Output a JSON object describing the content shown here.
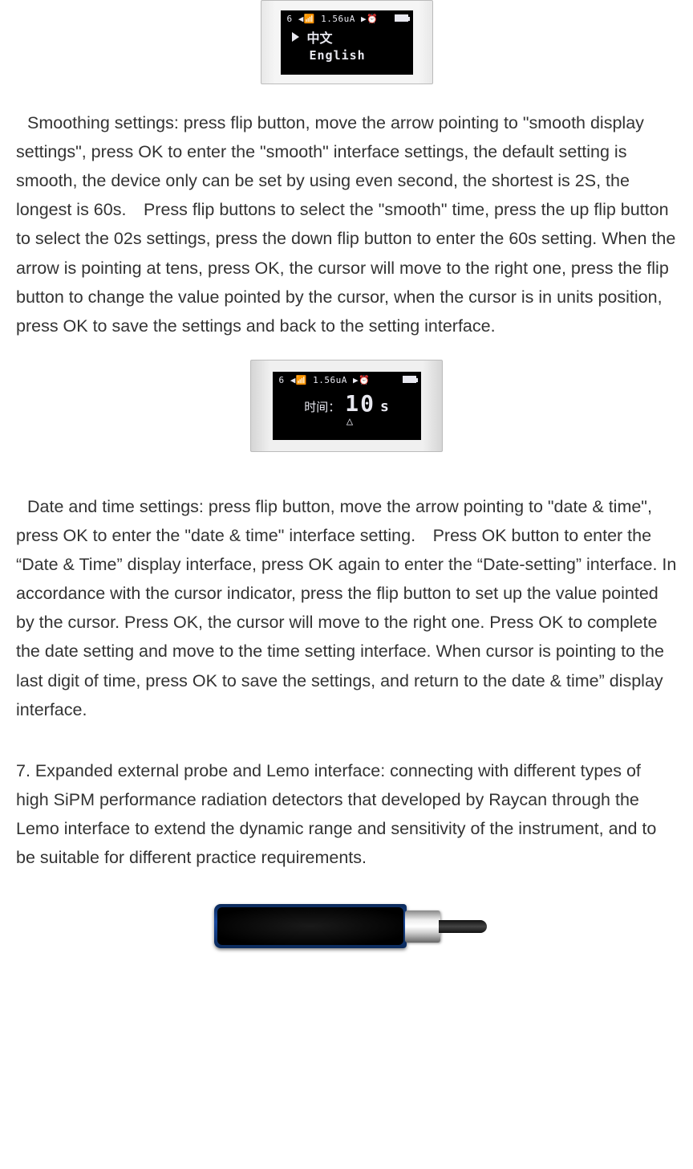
{
  "figure1": {
    "status": "6  ◀📶  1.56uA  ▶⏰",
    "row1_text": "中文",
    "row2_text": "English"
  },
  "para1": "Smoothing settings: press flip button, move the arrow pointing to \"smooth display settings\", press OK to enter the \"smooth\" interface settings, the default setting is smooth, the device only can be set by using even second, the shortest is 2S, the longest is 60s. Press flip buttons to select the \"smooth\" time, press the up flip button to select the 02s settings, press the down flip button to enter the 60s setting. When the arrow is pointing at tens, press OK, the cursor will move to the right one, press the flip button to change the value pointed by the cursor, when the cursor is in units position, press OK to save the settings and back to the setting interface.",
  "figure2": {
    "status": "6  ◀📶  1.56uA  ▶⏰",
    "label": "时间：",
    "value": "10",
    "unit": "s",
    "caret": "△"
  },
  "para2": "Date and time settings: press flip button, move the arrow pointing to \"date & time\", press OK to enter the \"date & time\" interface setting. Press OK button to enter the “Date & Time” display interface, press OK again to enter the “Date-setting” interface. In accordance with the cursor indicator, press the flip button to set up the value pointed by the cursor. Press OK, the cursor will move to the right one. Press OK to complete the date setting and move to the time setting interface. When cursor is pointing to the last digit of time, press OK to save the settings, and return to the date & time” display interface.",
  "para3": "7. Expanded external probe and Lemo interface: connecting with different types of high SiPM performance radiation detectors that developed by Raycan through the Lemo interface to extend the dynamic range and sensitivity of the instrument, and to be suitable for different practice requirements."
}
